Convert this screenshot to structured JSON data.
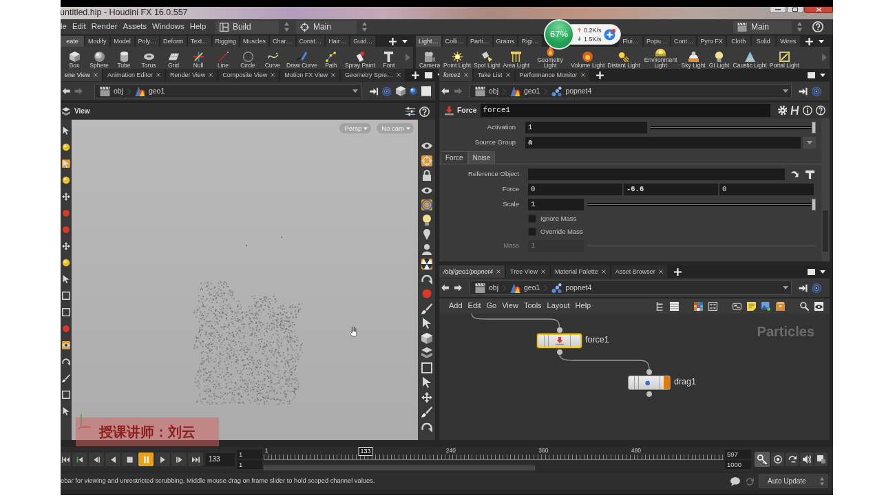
{
  "window": {
    "title": "untitled.hip - Houdini FX 16.0.557"
  },
  "menu_bar": {
    "menus": [
      "le",
      "Edit",
      "Render",
      "Assets",
      "Windows",
      "Help"
    ],
    "desktops": [
      "Build",
      "Main"
    ],
    "right_desktop": "Main"
  },
  "shelf_left": {
    "tabs": [
      {
        "label": "eate",
        "selected": true
      },
      {
        "label": "Modify",
        "selected": false
      },
      {
        "label": "Model",
        "selected": false
      },
      {
        "label": "Poly…",
        "selected": false
      },
      {
        "label": "Deform",
        "selected": false
      },
      {
        "label": "Text…",
        "selected": false
      },
      {
        "label": "Rigging",
        "selected": false
      },
      {
        "label": "Muscles",
        "selected": false
      },
      {
        "label": "Char…",
        "selected": false
      },
      {
        "label": "Const…",
        "selected": false
      },
      {
        "label": "Hair…",
        "selected": false
      },
      {
        "label": "Guid…",
        "selected": false
      }
    ],
    "tools": [
      "Box",
      "Sphere",
      "Tube",
      "Torus",
      "Grid",
      "Null",
      "Line",
      "Circle",
      "Curve",
      "Draw Curve",
      "Path",
      "Spray Paint",
      "Font"
    ]
  },
  "shelf_right": {
    "tabs": [
      {
        "label": "Light…",
        "selected": true
      },
      {
        "label": "Colli…",
        "selected": false
      },
      {
        "label": "Parti…",
        "selected": false
      },
      {
        "label": "Grains",
        "selected": false
      },
      {
        "label": "Rigi…",
        "selected": false
      },
      {
        "label": "Flui…",
        "selected": false
      },
      {
        "label": "Popu…",
        "selected": false
      },
      {
        "label": "Cont…",
        "selected": false
      },
      {
        "label": "Pyro FX",
        "selected": false
      },
      {
        "label": "Cloth",
        "selected": false
      },
      {
        "label": "Solid",
        "selected": false
      },
      {
        "label": "Wires",
        "selected": false
      }
    ],
    "tools": [
      "Camera",
      "Point Light",
      "Spot Light",
      "Area Light",
      "Geometry Light",
      "Volume Light",
      "Distant Light",
      "Environment Light",
      "Sky Light",
      "GI Light",
      "Caustic Light",
      "Portal Light"
    ]
  },
  "speed_widget": {
    "percent": "67%",
    "upload": "0.2K/s",
    "download": "1.5K/s"
  },
  "scene_pane": {
    "tabs": [
      {
        "label": "ene View",
        "selected": true
      },
      {
        "label": "Animation Editor",
        "selected": false
      },
      {
        "label": "Render View",
        "selected": false
      },
      {
        "label": "Composite View",
        "selected": false
      },
      {
        "label": "Motion FX View",
        "selected": false
      },
      {
        "label": "Geometry Spre…",
        "selected": false
      }
    ],
    "path": [
      "obj",
      "geo1"
    ],
    "viewer_title": "View",
    "view_menus": [
      "Persp",
      "No cam"
    ],
    "left_toolbar": [
      {
        "on": false
      },
      {
        "on": false
      },
      {
        "on": true
      },
      {
        "on": false
      },
      {
        "on": false
      },
      {
        "on": false
      },
      {
        "on": false
      },
      {
        "on": false
      },
      {
        "on": false
      },
      {
        "on": false
      },
      {
        "on": false
      },
      {
        "on": false
      },
      {
        "on": false
      },
      {
        "on": true
      },
      {
        "on": false
      },
      {
        "on": false
      },
      {
        "on": false
      },
      {
        "on": false
      }
    ],
    "right_toolbar": [
      {
        "on": false
      },
      {
        "on": true
      },
      {
        "on": false
      },
      {
        "on": false
      },
      {
        "on": true
      },
      {
        "on": false
      },
      {
        "on": false
      },
      {
        "on": false
      },
      {
        "on": true
      },
      {
        "on": false
      },
      {
        "on": false
      },
      {
        "on": false
      },
      {
        "on": false
      },
      {
        "on": false
      },
      {
        "on": false
      },
      {
        "on": false
      },
      {
        "on": false
      },
      {
        "on": false
      },
      {
        "on": false
      },
      {
        "on": false
      }
    ]
  },
  "caption": "授课讲师：刘云",
  "parameter_pane": {
    "tabs": [
      {
        "label": "force1",
        "selected": true
      },
      {
        "label": "Take List",
        "selected": false
      },
      {
        "label": "Performance Monitor",
        "selected": false
      }
    ],
    "path": [
      "obj",
      "geo1",
      "popnet4"
    ],
    "node_type": "Force",
    "node_name": "force1",
    "rows": [
      {
        "kind": "slider",
        "label": "Activation",
        "value": "1",
        "modified": false,
        "level": 1,
        "disabled": false
      },
      {
        "kind": "menu",
        "label": "Source Group",
        "value": "a",
        "modified": true,
        "disabled": false
      }
    ],
    "folders": [
      {
        "label": "Force",
        "selected": true
      },
      {
        "label": "Noise",
        "selected": false
      }
    ],
    "folder_rows": [
      {
        "kind": "operator",
        "label": "Reference Object",
        "disabled": false
      },
      {
        "kind": "vector",
        "label": "Force",
        "values": [
          {
            "value": "0",
            "modified": false
          },
          {
            "value": "-6.6",
            "modified": true
          },
          {
            "value": "0",
            "modified": false
          }
        ],
        "disabled": false
      },
      {
        "kind": "slider",
        "label": "Scale",
        "value": "1",
        "modified": false,
        "level": 1,
        "disabled": false
      },
      {
        "kind": "checkbox",
        "label": "Ignore Mass",
        "checked": false,
        "disabled": false
      },
      {
        "kind": "checkbox",
        "label": "Override Mass",
        "checked": false,
        "disabled": false
      },
      {
        "kind": "slider",
        "label": "Mass",
        "value": "1",
        "modified": false,
        "disabled": true
      }
    ]
  },
  "network_pane": {
    "tabs": [
      {
        "label": "/obj/geo1/popnet4",
        "selected": true
      },
      {
        "label": "Tree View",
        "selected": false
      },
      {
        "label": "Material Palette",
        "selected": false
      },
      {
        "label": "Asset Browser",
        "selected": false
      }
    ],
    "path": [
      "obj",
      "geo1",
      "popnet4"
    ],
    "menus": [
      "Add",
      "Edit",
      "Go",
      "View",
      "Tools",
      "Layout",
      "Help"
    ],
    "context_label": "Particles",
    "nodes": [
      {
        "name": "force1",
        "selected": true,
        "display_flag": false
      },
      {
        "name": "drag1",
        "selected": false,
        "display_flag": true
      }
    ]
  },
  "timeline": {
    "playing": true,
    "frame": "133",
    "range_start": "1",
    "global_start": "1",
    "ruler_labels": [
      "1",
      "240",
      "360",
      "480"
    ],
    "marker": "133",
    "range_end": "597",
    "global_end": "1000"
  },
  "status_bar": {
    "message": "ebar for viewing and unrestricted scrubbing. Middle mouse drag on frame slider to hold scoped channel values.",
    "update_mode": "Auto Update"
  }
}
